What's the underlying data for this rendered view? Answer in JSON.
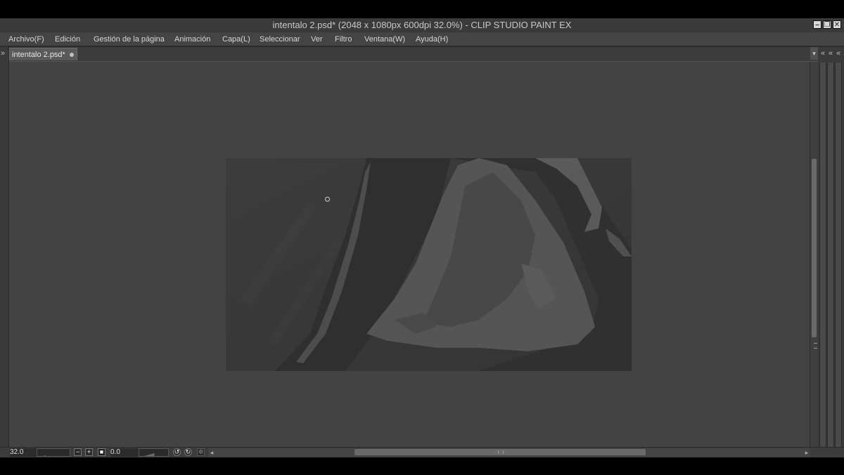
{
  "window": {
    "title": "intentalo 2.psd* (2048 x 1080px 600dpi 32.0%)  - CLIP STUDIO PAINT EX",
    "controls": [
      "minimize-icon",
      "restore-icon",
      "close-icon"
    ]
  },
  "menu": {
    "items": [
      "Archivo(F)",
      "Edición",
      "Gestión de la página",
      "Animación",
      "Capa(L)",
      "Seleccionar",
      "Ver",
      "Filtro",
      "Ventana(W)",
      "Ayuda(H)"
    ]
  },
  "tabs": [
    {
      "label": "intentalo 2.psd*",
      "active": true
    }
  ],
  "status": {
    "zoom": "32.0",
    "rotation": "0.0",
    "zoom_slider_fraction": 0.25,
    "rotation_slider_fraction": 0.5
  },
  "colors": {
    "canvas_bg": "#434343",
    "artwork_base": "#3a3a3a",
    "chrome": "#3c3c3c"
  }
}
